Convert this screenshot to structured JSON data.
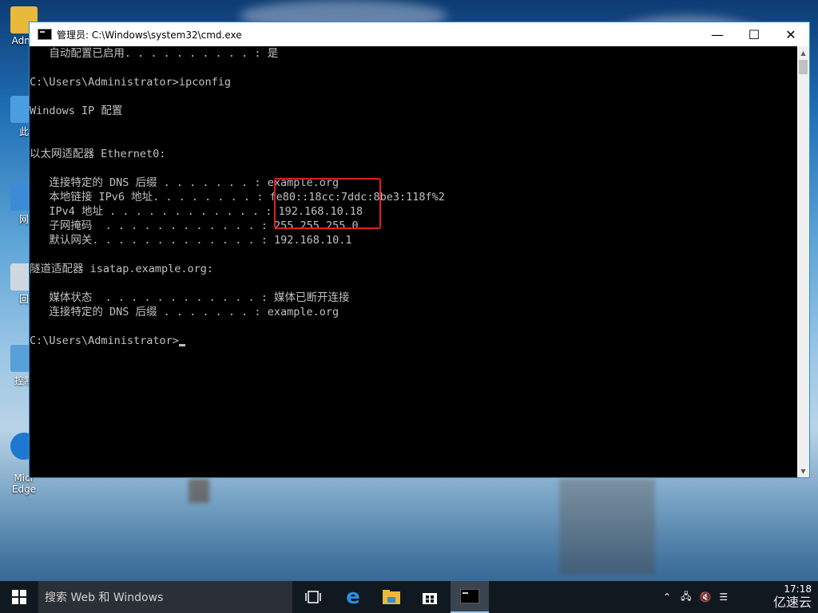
{
  "window": {
    "title": "管理员: C:\\Windows\\system32\\cmd.exe",
    "minimize_glyph": "—",
    "maximize_glyph": "☐",
    "close_glyph": "✕"
  },
  "console": {
    "lines": [
      "   自动配置已启用. . . . . . . . . . : 是",
      "",
      "C:\\Users\\Administrator>ipconfig",
      "",
      "Windows IP 配置",
      "",
      "",
      "以太网适配器 Ethernet0:",
      "",
      "   连接特定的 DNS 后缀 . . . . . . . : example.org",
      "   本地链接 IPv6 地址. . . . . . . . : fe80::18cc:7ddc:8be3:118f%2",
      "   IPv4 地址 . . . . . . . . . . . . : 192.168.10.18",
      "   子网掩码  . . . . . . . . . . . . : 255.255.255.0",
      "   默认网关. . . . . . . . . . . . . : 192.168.10.1",
      "",
      "隧道适配器 isatap.example.org:",
      "",
      "   媒体状态  . . . . . . . . . . . . : 媒体已断开连接",
      "   连接特定的 DNS 后缀 . . . . . . . : example.org",
      "",
      "C:\\Users\\Administrator>"
    ]
  },
  "desktop": {
    "icons": [
      "Admi",
      "此",
      "网",
      "回",
      "控制",
      "Micr\nEdge"
    ]
  },
  "taskbar": {
    "search_placeholder": "搜索 Web 和 Windows",
    "clock_time": "17:18",
    "watermark": "亿速云"
  },
  "colors": {
    "highlight": "#e0201c",
    "window_border": "#1e90d6",
    "console_text": "#c0c0c0"
  }
}
